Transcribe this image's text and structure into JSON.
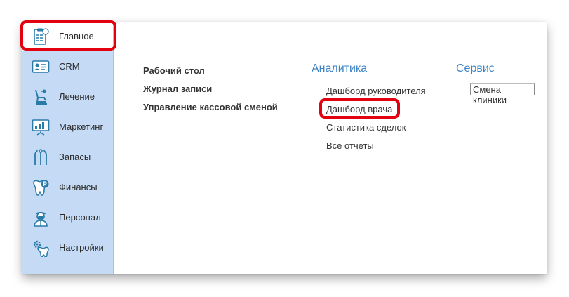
{
  "sidebar": {
    "items": [
      {
        "label": "Главное",
        "icon": "clipboard-tooth-icon",
        "active": true
      },
      {
        "label": "CRM",
        "icon": "id-card-icon"
      },
      {
        "label": "Лечение",
        "icon": "dental-chair-icon"
      },
      {
        "label": "Маркетинг",
        "icon": "chart-board-icon"
      },
      {
        "label": "Запасы",
        "icon": "dental-tools-icon"
      },
      {
        "label": "Финансы",
        "icon": "tooth-ruble-icon"
      },
      {
        "label": "Персонал",
        "icon": "doctor-icon"
      },
      {
        "label": "Настройки",
        "icon": "tooth-gear-icon"
      }
    ]
  },
  "main": {
    "left_links": [
      "Рабочий стол",
      "Журнал записи",
      "Управление кассовой сменой"
    ],
    "analytics": {
      "title": "Аналитика",
      "links": [
        "Дашборд руководителя",
        "Дашборд врача",
        "Статистика сделок",
        "Все отчеты"
      ]
    },
    "service": {
      "title": "Сервис",
      "button": "Смена клиники"
    }
  },
  "colors": {
    "sidebar_bg": "#c5dbf5",
    "accent": "#3c83c4",
    "highlight": "#e3000f",
    "icon": "#2a7aa8"
  }
}
